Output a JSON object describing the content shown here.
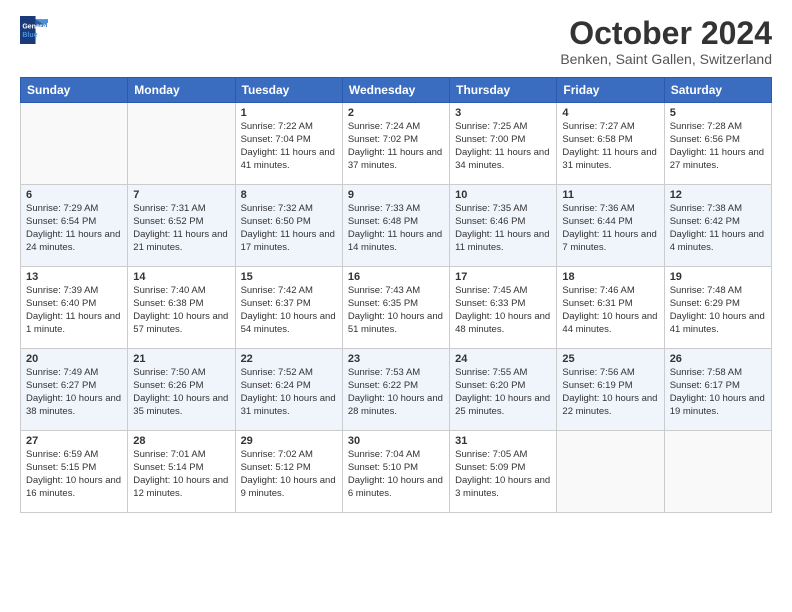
{
  "logo": {
    "line1": "General",
    "line2": "Blue"
  },
  "title": "October 2024",
  "subtitle": "Benken, Saint Gallen, Switzerland",
  "headers": [
    "Sunday",
    "Monday",
    "Tuesday",
    "Wednesday",
    "Thursday",
    "Friday",
    "Saturday"
  ],
  "weeks": [
    [
      {
        "day": "",
        "info": ""
      },
      {
        "day": "",
        "info": ""
      },
      {
        "day": "1",
        "info": "Sunrise: 7:22 AM\nSunset: 7:04 PM\nDaylight: 11 hours and 41 minutes."
      },
      {
        "day": "2",
        "info": "Sunrise: 7:24 AM\nSunset: 7:02 PM\nDaylight: 11 hours and 37 minutes."
      },
      {
        "day": "3",
        "info": "Sunrise: 7:25 AM\nSunset: 7:00 PM\nDaylight: 11 hours and 34 minutes."
      },
      {
        "day": "4",
        "info": "Sunrise: 7:27 AM\nSunset: 6:58 PM\nDaylight: 11 hours and 31 minutes."
      },
      {
        "day": "5",
        "info": "Sunrise: 7:28 AM\nSunset: 6:56 PM\nDaylight: 11 hours and 27 minutes."
      }
    ],
    [
      {
        "day": "6",
        "info": "Sunrise: 7:29 AM\nSunset: 6:54 PM\nDaylight: 11 hours and 24 minutes."
      },
      {
        "day": "7",
        "info": "Sunrise: 7:31 AM\nSunset: 6:52 PM\nDaylight: 11 hours and 21 minutes."
      },
      {
        "day": "8",
        "info": "Sunrise: 7:32 AM\nSunset: 6:50 PM\nDaylight: 11 hours and 17 minutes."
      },
      {
        "day": "9",
        "info": "Sunrise: 7:33 AM\nSunset: 6:48 PM\nDaylight: 11 hours and 14 minutes."
      },
      {
        "day": "10",
        "info": "Sunrise: 7:35 AM\nSunset: 6:46 PM\nDaylight: 11 hours and 11 minutes."
      },
      {
        "day": "11",
        "info": "Sunrise: 7:36 AM\nSunset: 6:44 PM\nDaylight: 11 hours and 7 minutes."
      },
      {
        "day": "12",
        "info": "Sunrise: 7:38 AM\nSunset: 6:42 PM\nDaylight: 11 hours and 4 minutes."
      }
    ],
    [
      {
        "day": "13",
        "info": "Sunrise: 7:39 AM\nSunset: 6:40 PM\nDaylight: 11 hours and 1 minute."
      },
      {
        "day": "14",
        "info": "Sunrise: 7:40 AM\nSunset: 6:38 PM\nDaylight: 10 hours and 57 minutes."
      },
      {
        "day": "15",
        "info": "Sunrise: 7:42 AM\nSunset: 6:37 PM\nDaylight: 10 hours and 54 minutes."
      },
      {
        "day": "16",
        "info": "Sunrise: 7:43 AM\nSunset: 6:35 PM\nDaylight: 10 hours and 51 minutes."
      },
      {
        "day": "17",
        "info": "Sunrise: 7:45 AM\nSunset: 6:33 PM\nDaylight: 10 hours and 48 minutes."
      },
      {
        "day": "18",
        "info": "Sunrise: 7:46 AM\nSunset: 6:31 PM\nDaylight: 10 hours and 44 minutes."
      },
      {
        "day": "19",
        "info": "Sunrise: 7:48 AM\nSunset: 6:29 PM\nDaylight: 10 hours and 41 minutes."
      }
    ],
    [
      {
        "day": "20",
        "info": "Sunrise: 7:49 AM\nSunset: 6:27 PM\nDaylight: 10 hours and 38 minutes."
      },
      {
        "day": "21",
        "info": "Sunrise: 7:50 AM\nSunset: 6:26 PM\nDaylight: 10 hours and 35 minutes."
      },
      {
        "day": "22",
        "info": "Sunrise: 7:52 AM\nSunset: 6:24 PM\nDaylight: 10 hours and 31 minutes."
      },
      {
        "day": "23",
        "info": "Sunrise: 7:53 AM\nSunset: 6:22 PM\nDaylight: 10 hours and 28 minutes."
      },
      {
        "day": "24",
        "info": "Sunrise: 7:55 AM\nSunset: 6:20 PM\nDaylight: 10 hours and 25 minutes."
      },
      {
        "day": "25",
        "info": "Sunrise: 7:56 AM\nSunset: 6:19 PM\nDaylight: 10 hours and 22 minutes."
      },
      {
        "day": "26",
        "info": "Sunrise: 7:58 AM\nSunset: 6:17 PM\nDaylight: 10 hours and 19 minutes."
      }
    ],
    [
      {
        "day": "27",
        "info": "Sunrise: 6:59 AM\nSunset: 5:15 PM\nDaylight: 10 hours and 16 minutes."
      },
      {
        "day": "28",
        "info": "Sunrise: 7:01 AM\nSunset: 5:14 PM\nDaylight: 10 hours and 12 minutes."
      },
      {
        "day": "29",
        "info": "Sunrise: 7:02 AM\nSunset: 5:12 PM\nDaylight: 10 hours and 9 minutes."
      },
      {
        "day": "30",
        "info": "Sunrise: 7:04 AM\nSunset: 5:10 PM\nDaylight: 10 hours and 6 minutes."
      },
      {
        "day": "31",
        "info": "Sunrise: 7:05 AM\nSunset: 5:09 PM\nDaylight: 10 hours and 3 minutes."
      },
      {
        "day": "",
        "info": ""
      },
      {
        "day": "",
        "info": ""
      }
    ]
  ]
}
